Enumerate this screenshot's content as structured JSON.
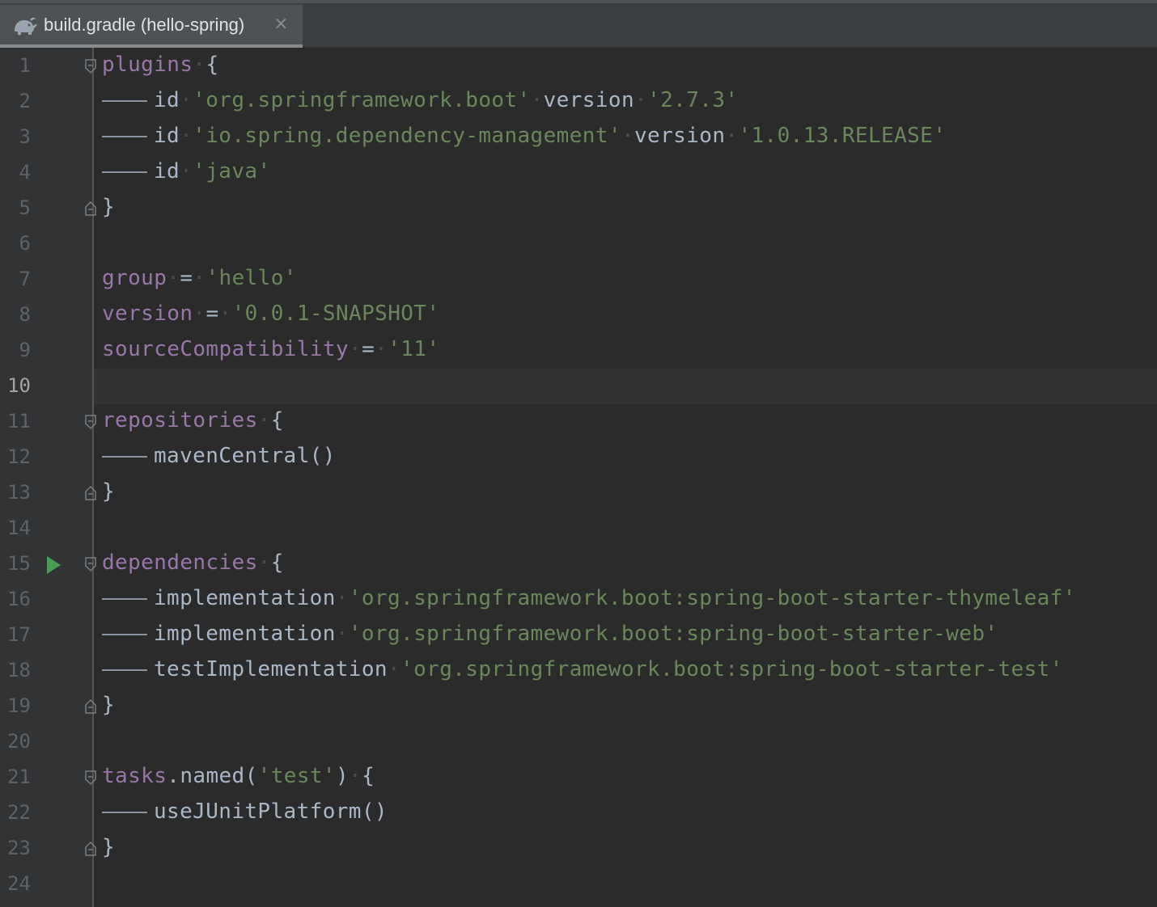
{
  "tab": {
    "label": "build.gradle (hello-spring)",
    "icon": "gradle-elephant-icon",
    "close_icon": "×"
  },
  "colors": {
    "background": "#2b2b2b",
    "property": "#9876aa",
    "string": "#6a8759",
    "plain": "#a9b7c6",
    "run": "#499c54"
  },
  "current_line": 10,
  "line_numbers": [
    "1",
    "2",
    "3",
    "4",
    "5",
    "6",
    "7",
    "8",
    "9",
    "10",
    "11",
    "12",
    "13",
    "14",
    "15",
    "16",
    "17",
    "18",
    "19",
    "20",
    "21",
    "22",
    "23",
    "24"
  ],
  "code": {
    "l1_kw": "plugins",
    "l1_brace": "{",
    "l2_id": "id",
    "l2_str": "'org.springframework.boot'",
    "l2_ver": "version",
    "l2_vstr": "'2.7.3'",
    "l3_id": "id",
    "l3_str": "'io.spring.dependency-management'",
    "l3_ver": "version",
    "l3_vstr": "'1.0.13.RELEASE'",
    "l4_id": "id",
    "l4_str": "'java'",
    "close": "}",
    "l7_prop": "group",
    "l7_eq": "=",
    "l7_str": "'hello'",
    "l8_prop": "version",
    "l8_eq": "=",
    "l8_str": "'0.0.1-SNAPSHOT'",
    "l9_prop": "sourceCompatibility",
    "l9_eq": "=",
    "l9_str": "'11'",
    "l11_kw": "repositories",
    "l11_brace": "{",
    "l12_call": "mavenCentral()",
    "l15_kw": "dependencies",
    "l15_brace": "{",
    "l16_kw": "implementation",
    "l16_str": "'org.springframework.boot:spring-boot-starter-thymeleaf'",
    "l17_kw": "implementation",
    "l17_str": "'org.springframework.boot:spring-boot-starter-web'",
    "l18_kw": "testImplementation",
    "l18_str": "'org.springframework.boot:spring-boot-starter-test'",
    "l21_prop": "tasks",
    "l21_call": ".named(",
    "l21_str": "'test'",
    "l21_end": ")",
    "l21_brace": "{",
    "l22_call": "useJUnitPlatform()"
  }
}
